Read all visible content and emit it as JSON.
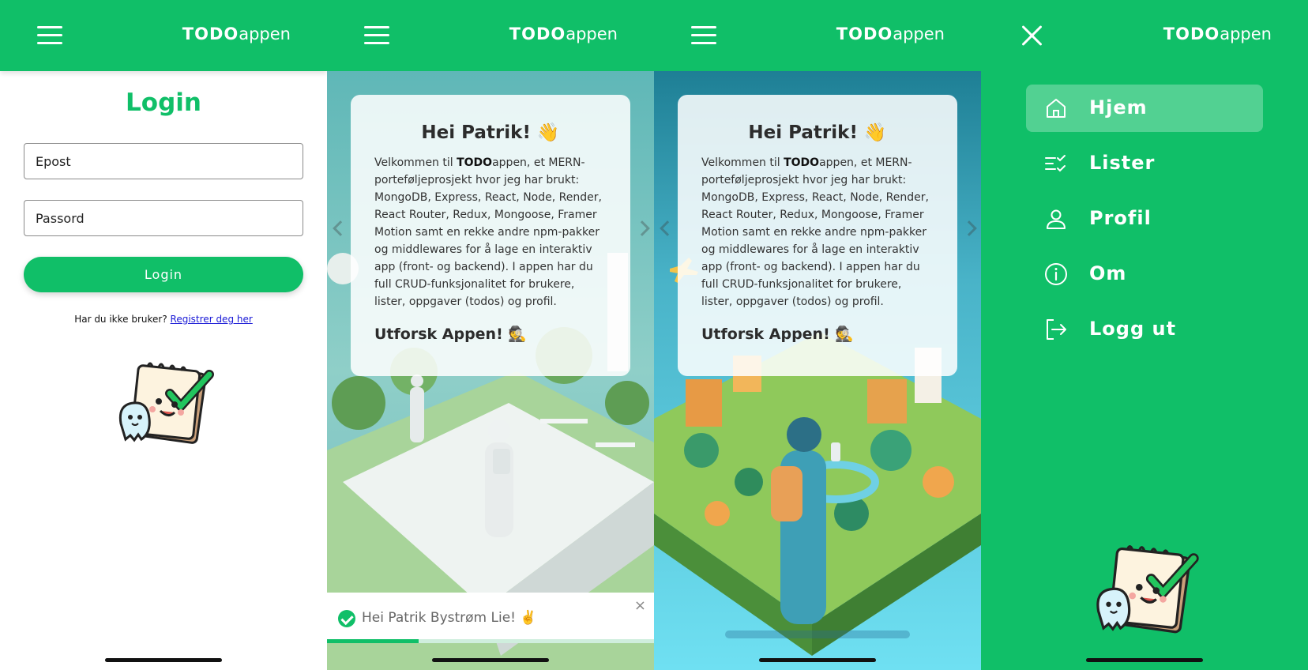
{
  "colors": {
    "brand": "#10bf68",
    "link": "#1a1ad6",
    "white": "#ffffff"
  },
  "header": {
    "logo_bold": "TODO",
    "logo_light": "appen",
    "menu_icon": "hamburger-icon",
    "close_icon": "close-icon"
  },
  "login": {
    "title": "Login",
    "email_placeholder": "Epost",
    "password_placeholder": "Passord",
    "button_label": "Login",
    "register_prompt": "Har du ikke bruker?",
    "register_link": "Registrer deg her"
  },
  "welcome": {
    "title": "Hei Patrik! 👋",
    "intro_prefix": "Velkommen til ",
    "intro_brand": "TODO",
    "intro_text": "appen, et MERN-porteføljeprosjekt hvor jeg har brukt: MongoDB, Express, React, Node, Render, React Router, Redux, Mongoose, Framer Motion samt en rekke andre npm-pakker og middlewares for å lage en interaktiv app (front- og backend). I appen har du full CRUD-funksjonalitet for brukere, lister, oppgaver (todos) og profil.",
    "cta": "Utforsk Appen! 🕵️"
  },
  "toast": {
    "message": "Hei Patrik Bystrøm Lie! ✌️",
    "close": "×",
    "progress_fraction": 0.28
  },
  "menu": {
    "items": [
      {
        "label": "Hjem",
        "icon": "home-icon",
        "active": true
      },
      {
        "label": "Lister",
        "icon": "checklist-icon",
        "active": false
      },
      {
        "label": "Profil",
        "icon": "user-icon",
        "active": false
      },
      {
        "label": "Om",
        "icon": "info-icon",
        "active": false
      },
      {
        "label": "Logg ut",
        "icon": "logout-icon",
        "active": false
      }
    ]
  }
}
